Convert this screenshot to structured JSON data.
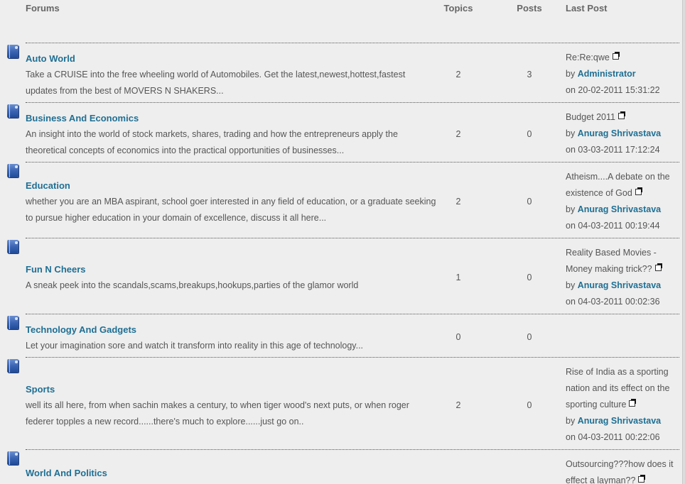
{
  "header": {
    "forums": "Forums",
    "topics": "Topics",
    "posts": "Posts",
    "last_post": "Last Post"
  },
  "by_label": "by",
  "on_label": "on",
  "forums": [
    {
      "title": "Auto World",
      "description": "Take a CRUISE into the free wheeling world of Automobiles. Get the latest,newest,hottest,fastest updates from the best of MOVERS N SHAKERS...",
      "topics": "2",
      "posts": "3",
      "last_post": {
        "title": "Re:Re:qwe",
        "user": "Administrator",
        "date": "20-02-2011 15:31:22"
      }
    },
    {
      "title": "Business And Economics",
      "description": "An insight into the world of stock markets, shares, trading and how the entrepreneurs apply the theoretical concepts of economics into the practical opportunities of businesses...",
      "topics": "2",
      "posts": "0",
      "last_post": {
        "title": "Budget 2011",
        "user": "Anurag Shrivastava",
        "date": "03-03-2011 17:12:24"
      }
    },
    {
      "title": "Education",
      "description": "whether you are an MBA aspirant, school goer interested in any field of education, or a graduate seeking to pursue higher education in your domain of excellence, discuss it all here...",
      "topics": "2",
      "posts": "0",
      "last_post": {
        "title": "Atheism....A debate on the existence of God",
        "user": "Anurag Shrivastava",
        "date": "04-03-2011 00:19:44"
      }
    },
    {
      "title": "Fun N Cheers",
      "description": "A sneak peek into the scandals,scams,breakups,hookups,parties of the glamor world",
      "topics": "1",
      "posts": "0",
      "last_post": {
        "title": "Reality Based Movies - Money making trick??",
        "user": "Anurag Shrivastava",
        "date": "04-03-2011 00:02:36"
      }
    },
    {
      "title": "Technology And Gadgets",
      "description": "Let your imagination sore and watch it transform into reality in this age of technology...",
      "topics": "0",
      "posts": "0",
      "last_post": null
    },
    {
      "title": "Sports",
      "description": "well its all here, from when sachin makes a century, to when tiger wood's next puts, or when roger federer topples a new record......there's much to explore......just go on..",
      "topics": "2",
      "posts": "0",
      "last_post": {
        "title": "Rise of India as a sporting nation and its effect on the sporting culture",
        "user": "Anurag Shrivastava",
        "date": "04-03-2011 00:22:06"
      }
    },
    {
      "title": "World And Politics",
      "description": "",
      "topics": "",
      "posts": "",
      "last_post": {
        "title": "Outsourcing???how does it effect a layman??",
        "user": "",
        "date": ""
      }
    }
  ]
}
